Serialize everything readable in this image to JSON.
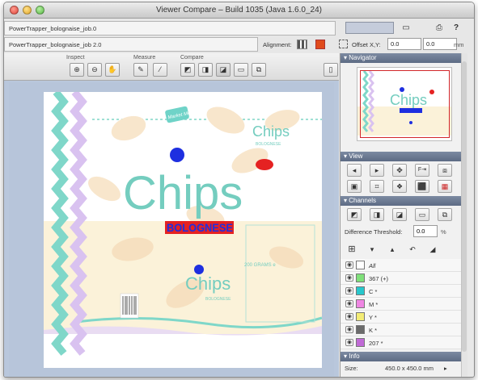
{
  "window": {
    "title": "Viewer Compare – Build 1035 (Java 1.6.0_24)"
  },
  "files": {
    "file1": "PowerTrapper_bolognaise_job.0",
    "file2": "PowerTrapper_bolognaise_job 2.0"
  },
  "alignment": {
    "label": "Alignment:"
  },
  "offset": {
    "label": "Offset X,Y:",
    "x": "0.0",
    "y": "0.0",
    "unit": "mm"
  },
  "toolbar": {
    "groups": {
      "inspect": "Inspect",
      "measure": "Measure",
      "compare": "Compare"
    }
  },
  "artwork": {
    "brand_small": "Market Meal",
    "title_big": "Chips",
    "title_small": "Chips",
    "sub": "BOLOGNESE",
    "sub_big": "BOLOGNESE",
    "grams": "200 GRAMS e"
  },
  "panel": {
    "navigator": "Navigator",
    "view": "View",
    "channels": "Channels",
    "threshold_label": "Difference Threshold:",
    "threshold_value": "0.0",
    "threshold_unit": "%",
    "info": "Info",
    "size_label": "Size:",
    "size_value": "450.0 x 450.0 mm"
  },
  "channels_list": [
    {
      "name": "All",
      "color": "#ffffff"
    },
    {
      "name": "367 (+)",
      "color": "#7fe07a"
    },
    {
      "name": "C *",
      "color": "#27c7cc"
    },
    {
      "name": "M *",
      "color": "#ef86e3"
    },
    {
      "name": "Y *",
      "color": "#f3ec76"
    },
    {
      "name": "K *",
      "color": "#6b6b6b"
    },
    {
      "name": "207 *",
      "color": "#c06ad6"
    }
  ],
  "colors": {
    "accent_teal": "#6fd3c8",
    "accent_lilac": "#d9c2f0",
    "difference_blue": "#1e2fe0",
    "difference_red": "#e52222"
  }
}
